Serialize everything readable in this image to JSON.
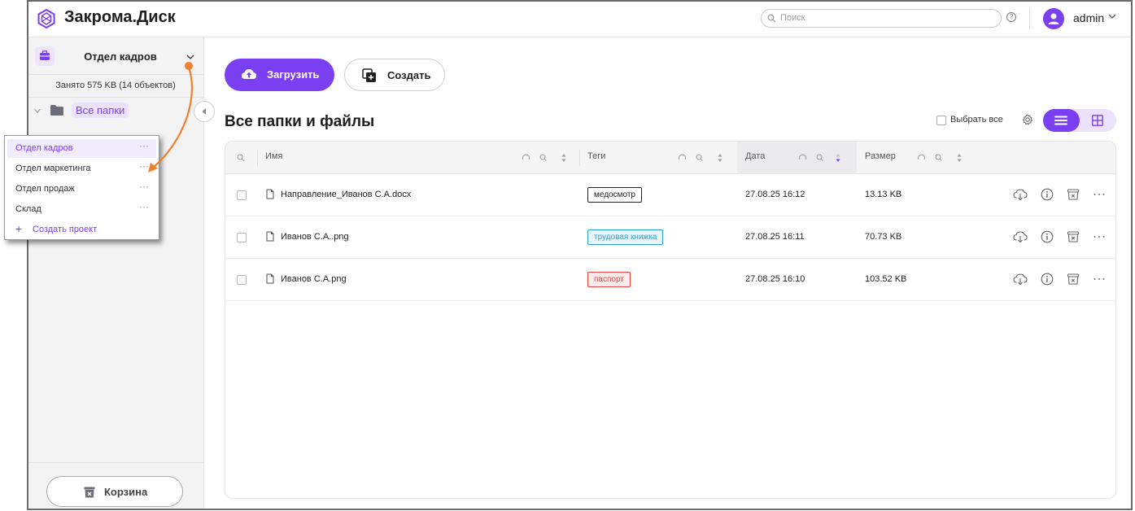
{
  "app": {
    "title": "Закрома.Диск"
  },
  "header": {
    "search_placeholder": "Поиск",
    "help_label": "?",
    "user_name": "admin"
  },
  "sidebar": {
    "project_name": "Отдел кадров",
    "usage": "Занято 575 KB (14 объектов)",
    "tree_root": "Все папки",
    "trash_label": "Корзина"
  },
  "toolbar": {
    "upload_label": "Загрузить",
    "create_label": "Создать"
  },
  "main": {
    "title": "Все папки и файлы",
    "select_all_label": "Выбрать все",
    "view_mode": "list"
  },
  "table": {
    "columns": [
      "Имя",
      "Теги",
      "Дата",
      "Размер"
    ],
    "rows": [
      {
        "name": "Направление_Иванов С.А.docx",
        "tag": "медосмотр",
        "tag_color": "#222222",
        "tag_bg": "#ffffff",
        "date": "27.08.25 16:12",
        "size": "13.13 KB"
      },
      {
        "name": "Иванов С.А..png",
        "tag": "трудовая книжка",
        "tag_color": "#2a9fd6",
        "tag_bg": "#e8f6fc",
        "date": "27.08.25 16:11",
        "size": "70.73 KB"
      },
      {
        "name": "Иванов С.А.png",
        "tag": "паспорт",
        "tag_color": "#e0463f",
        "tag_bg": "#fdeceb",
        "date": "27.08.25 16:10",
        "size": "103.52 KB"
      }
    ]
  },
  "project_menu": {
    "items": [
      {
        "label": "Отдел кадров",
        "active": true
      },
      {
        "label": "Отдел маркетинга",
        "active": false
      },
      {
        "label": "Отдел продаж",
        "active": false
      },
      {
        "label": "Склад",
        "active": false
      }
    ],
    "more_label": "···",
    "create_plus": "+",
    "create_label": "Создать проект"
  },
  "colors": {
    "accent": "#7b3ff2",
    "annotation": "#f07f2e"
  }
}
